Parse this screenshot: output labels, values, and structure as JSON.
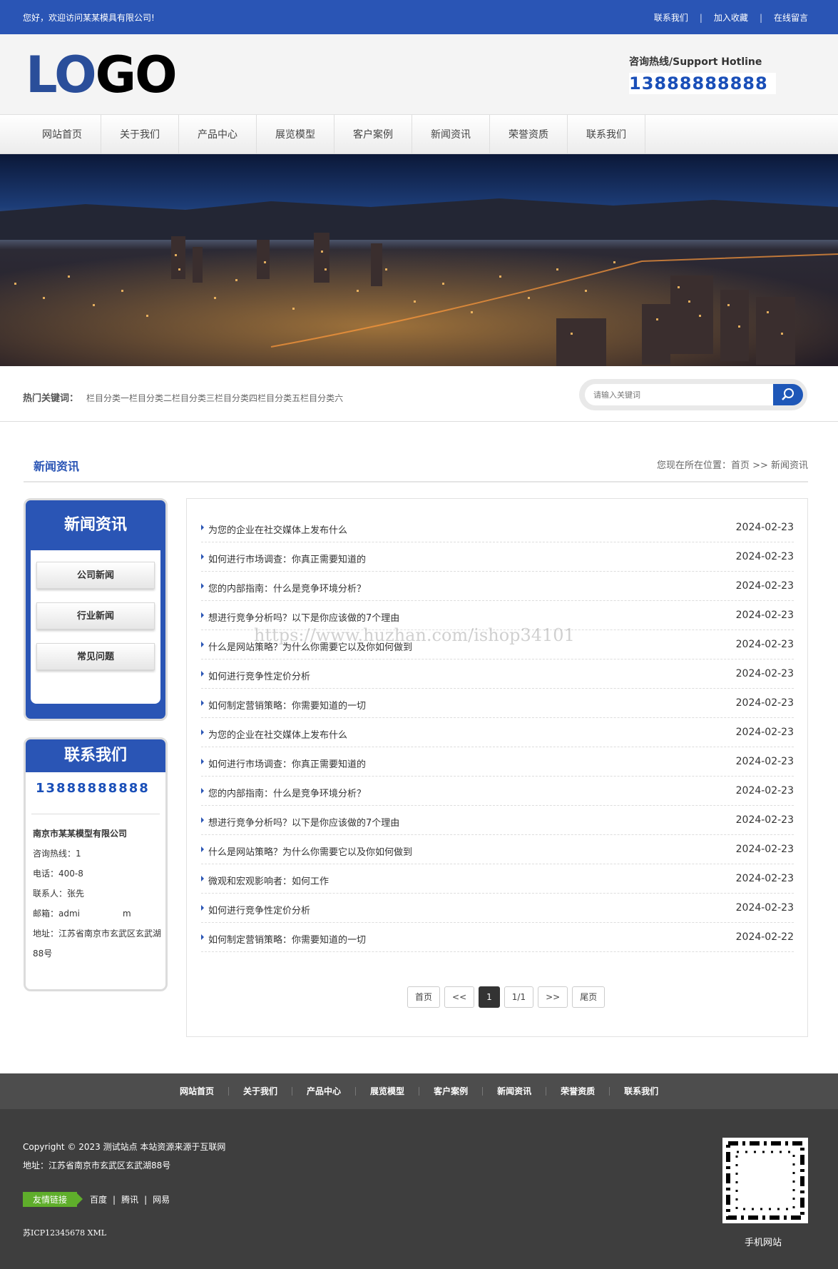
{
  "topbar": {
    "welcome": "您好，欢迎访问某某模具有限公司!",
    "links": [
      "联系我们",
      "加入收藏",
      "在线留言"
    ]
  },
  "header": {
    "logo_part1": "LO",
    "logo_part2": "GO",
    "hotline_label": "咨询热线/Support Hotline",
    "hotline_number": "13888888888"
  },
  "nav": {
    "items": [
      "网站首页",
      "关于我们",
      "产品中心",
      "展览模型",
      "客户案例",
      "新闻资讯",
      "荣誉资质",
      "联系我们"
    ]
  },
  "keywords": {
    "label": "热门关键词：",
    "items": [
      "栏目分类一",
      "栏目分类二",
      "栏目分类三",
      "栏目分类四",
      "栏目分类五",
      "栏目分类六"
    ]
  },
  "search": {
    "placeholder": "请输入关键词"
  },
  "section": {
    "title": "新闻资讯",
    "breadcrumb": "您现在所在位置：首页 >> 新闻资讯"
  },
  "sidebar": {
    "news_title": "新闻资讯",
    "categories": [
      "公司新闻",
      "行业新闻",
      "常见问题"
    ],
    "contact_title": "联系我们",
    "contact_phone": "13888888888",
    "company": "南京市某某模型有限公司",
    "hotline": "咨询热线：1",
    "tel": "电话：400-8",
    "contact_person": "联系人：张先",
    "email": "邮箱：admi",
    "email_tail": "m",
    "address": "地址：江苏省南京市玄武区玄武湖88号"
  },
  "news": [
    {
      "title": "为您的企业在社交媒体上发布什么",
      "date": "2024-02-23"
    },
    {
      "title": "如何进行市场调查：你真正需要知道的",
      "date": "2024-02-23"
    },
    {
      "title": "您的内部指南：什么是竞争环境分析？",
      "date": "2024-02-23"
    },
    {
      "title": "想进行竞争分析吗？以下是你应该做的7个理由",
      "date": "2024-02-23"
    },
    {
      "title": "什么是网站策略？为什么你需要它以及你如何做到",
      "date": "2024-02-23"
    },
    {
      "title": "如何进行竞争性定价分析",
      "date": "2024-02-23"
    },
    {
      "title": "如何制定营销策略：你需要知道的一切",
      "date": "2024-02-23"
    },
    {
      "title": "为您的企业在社交媒体上发布什么",
      "date": "2024-02-23"
    },
    {
      "title": "如何进行市场调查：你真正需要知道的",
      "date": "2024-02-23"
    },
    {
      "title": "您的内部指南：什么是竞争环境分析？",
      "date": "2024-02-23"
    },
    {
      "title": "想进行竞争分析吗？以下是你应该做的7个理由",
      "date": "2024-02-23"
    },
    {
      "title": "什么是网站策略？为什么你需要它以及你如何做到",
      "date": "2024-02-23"
    },
    {
      "title": "微观和宏观影响者：如何工作",
      "date": "2024-02-23"
    },
    {
      "title": "如何进行竞争性定价分析",
      "date": "2024-02-23"
    },
    {
      "title": "如何制定营销策略：你需要知道的一切",
      "date": "2024-02-22"
    }
  ],
  "pager": {
    "first": "首页",
    "prev": "<<",
    "current": "1",
    "pages": "1/1",
    "next": ">>",
    "last": "尾页"
  },
  "watermark": "https://www.huzhan.com/ishop34101",
  "footer": {
    "nav": [
      "网站首页",
      "关于我们",
      "产品中心",
      "展览模型",
      "客户案例",
      "新闻资讯",
      "荣誉资质",
      "联系我们"
    ],
    "copyright": "Copyright © 2023 测试站点 本站资源来源于互联网",
    "address": "地址：江苏省南京市玄武区玄武湖88号",
    "friend_label": "友情链接",
    "friend_links": [
      "百度",
      "腾讯",
      "网易"
    ],
    "icp": "苏ICP12345678 XML",
    "qr_label": "手机网站"
  },
  "colors": {
    "primary": "#2a55b5",
    "footer_dark": "#3e3e3e",
    "footer_nav": "#4d4d4d",
    "friend_tag": "#5fae2b"
  }
}
